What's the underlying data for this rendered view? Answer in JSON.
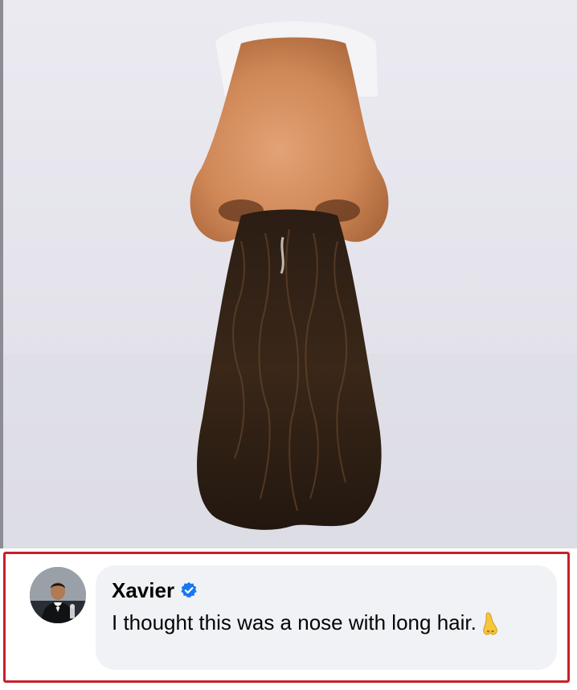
{
  "comment": {
    "author": "Xavier",
    "text": "I thought this was a nose with long hair.",
    "emoji": "👃",
    "verified": true
  },
  "icons": {
    "verified": "verified-badge-icon",
    "emoji": "nose-emoji-icon",
    "avatar": "profile-avatar"
  },
  "colors": {
    "highlight_border": "#c8202a",
    "bubble_background": "#f0f2f5",
    "verified_blue": "#1877f2"
  }
}
